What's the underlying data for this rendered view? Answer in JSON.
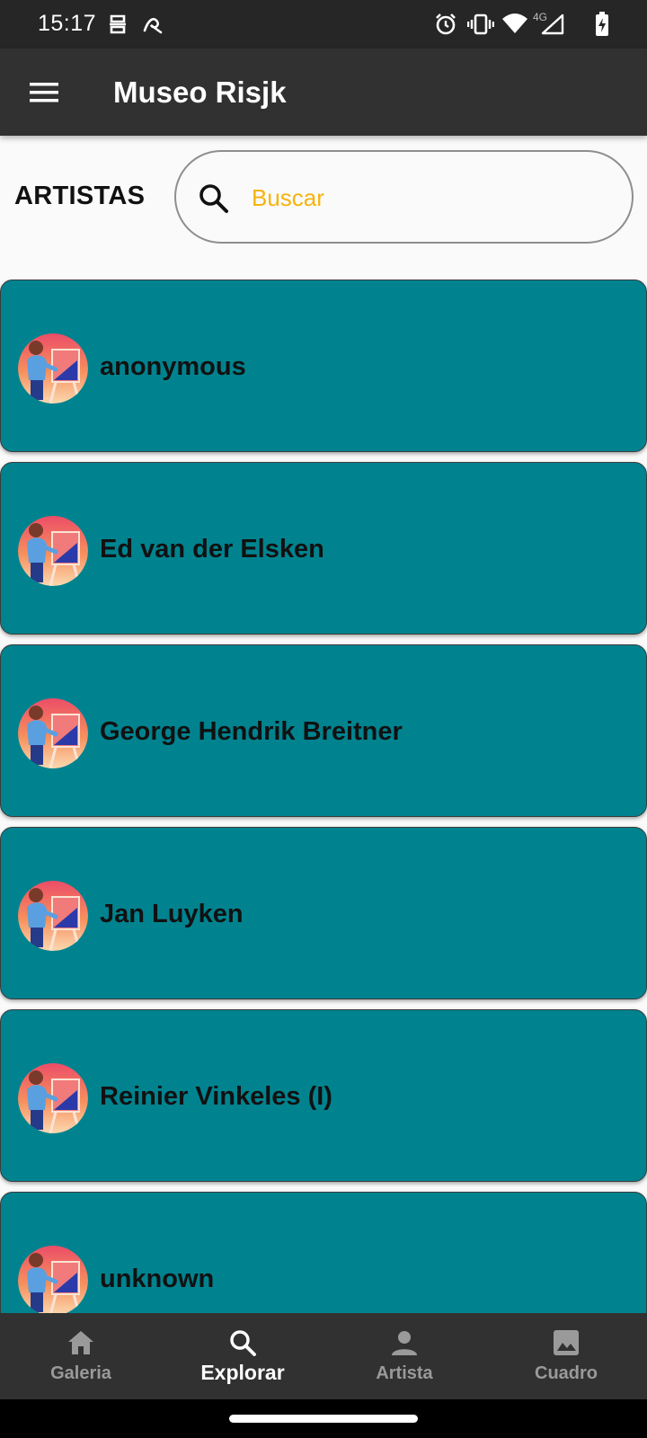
{
  "status_bar": {
    "time": "15:17",
    "network": "4G",
    "icons": [
      "vpn-key-icon",
      "signal-assistant-icon",
      "alarm-icon",
      "vibrate-icon",
      "wifi-icon",
      "cell-signal-icon",
      "battery-charging-icon"
    ]
  },
  "app_bar": {
    "title": "Museo Risjk",
    "menu_icon": "hamburger-menu-icon"
  },
  "header": {
    "section_title": "ARTISTAS",
    "search": {
      "placeholder": "Buscar",
      "value": "",
      "icon": "search-icon"
    }
  },
  "artists": [
    {
      "name": "anonymous"
    },
    {
      "name": "Ed van der Elsken"
    },
    {
      "name": "George Hendrik Breitner"
    },
    {
      "name": "Jan Luyken"
    },
    {
      "name": "Reinier Vinkeles (I)"
    },
    {
      "name": "unknown"
    }
  ],
  "bottom_nav": {
    "items": [
      {
        "label": "Galeria",
        "icon": "home-icon",
        "active": false
      },
      {
        "label": "Explorar",
        "icon": "search-icon",
        "active": true
      },
      {
        "label": "Artista",
        "icon": "person-icon",
        "active": false
      },
      {
        "label": "Cuadro",
        "icon": "image-icon",
        "active": false
      }
    ]
  },
  "colors": {
    "app_bar": "#313131",
    "card": "#00838f",
    "placeholder": "#f5b40a",
    "nav_active": "#ffffff",
    "nav_inactive": "#9a9a9a"
  }
}
